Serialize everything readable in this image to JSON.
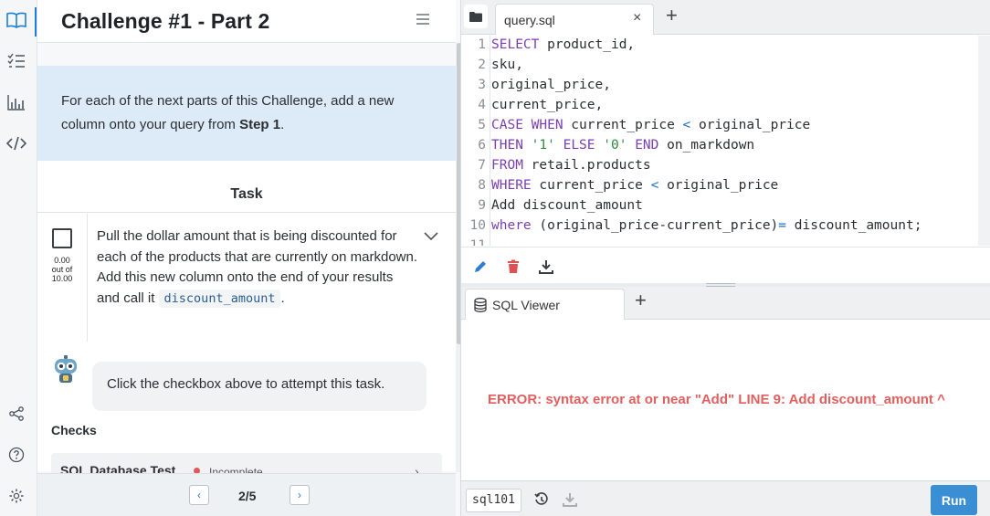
{
  "rail": {
    "icons": [
      "book-icon",
      "list-icon",
      "chart-icon",
      "code-icon",
      "share-icon",
      "help-icon",
      "settings-icon"
    ]
  },
  "lesson": {
    "title": "Challenge #1 - Part 2",
    "instruction_prefix": "For each of the next parts of this Challenge, add a new column onto your query from ",
    "instruction_bold": "Step 1",
    "instruction_suffix": ".",
    "task_heading": "Task",
    "score_value": "0.00",
    "score_outof": "out of",
    "score_max": "10.00",
    "task_text": "Pull the dollar amount that is being discounted for each of the products that are currently on markdown. Add this new column onto the end of your results and call it ",
    "task_code": "discount_amount",
    "task_suffix": ".",
    "bot_message": "Click the checkbox above to attempt this task.",
    "checks_label": "Checks",
    "check_name": "SQL Database Test",
    "check_status": "Incomplete",
    "pagination": "2/5",
    "prev_label": "‹",
    "next_label": "›"
  },
  "editor": {
    "tab_name": "query.sql",
    "close_label": "×",
    "add_label": "+",
    "line_numbers": [
      "1",
      "2",
      "3",
      "4",
      "5",
      "6",
      "7",
      "8",
      "9",
      "10",
      "11"
    ],
    "lines": {
      "l1_kw": "SELECT",
      "l1_rest": " product_id,",
      "l2": "sku,",
      "l3": "original_price,",
      "l4": "current_price,",
      "l5_kw1": "CASE",
      "l5_kw2": "WHEN",
      "l5_mid": " current_price ",
      "l5_op": "<",
      "l5_end": " original_price",
      "l6_kw1": "THEN",
      "l6_str1": "'1'",
      "l6_kw2": "ELSE",
      "l6_str2": "'0'",
      "l6_kw3": "END",
      "l6_end": " on_markdown",
      "l7_kw": "FROM",
      "l7_rest": " retail.products",
      "l8_kw": "WHERE",
      "l8_mid": " current_price ",
      "l8_op": "<",
      "l8_end": " original_price",
      "l9": "Add discount_amount",
      "l10_kw": "where",
      "l10_mid": " (original_price-current_price)",
      "l10_op": "=",
      "l10_end": " discount_amount;"
    }
  },
  "results": {
    "tab_name": "SQL Viewer",
    "add_label": "+",
    "error": "ERROR: syntax error at or near \"Add\" LINE 9: Add discount_amount ^",
    "database": "sql101",
    "run_label": "Run"
  },
  "colors": {
    "accent": "#1d7fd6",
    "instruction_bg": "#dcebf7",
    "error": "#e0605f",
    "run_button": "#3a8fd4",
    "keyword": "#7a3fb0",
    "string": "#2f8a3c",
    "delete_icon": "#e05252"
  }
}
